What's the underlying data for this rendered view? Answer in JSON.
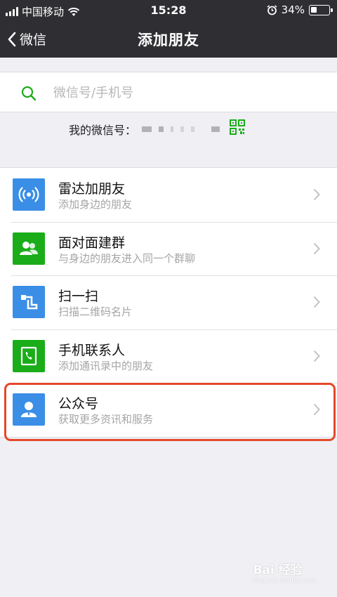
{
  "status_bar": {
    "carrier": "中国移动",
    "time": "15:28",
    "battery": "34%",
    "battery_level": 0.34
  },
  "nav": {
    "back_label": "微信",
    "title": "添加朋友"
  },
  "search": {
    "placeholder": "微信号/手机号"
  },
  "my_id": {
    "label": "我的微信号："
  },
  "menu": {
    "items": [
      {
        "title": "雷达加朋友",
        "subtitle": "添加身边的朋友",
        "icon": "radar-icon",
        "color": "#3a8ee6"
      },
      {
        "title": "面对面建群",
        "subtitle": "与身边的朋友进入同一个群聊",
        "icon": "group-icon",
        "color": "#1aad19"
      },
      {
        "title": "扫一扫",
        "subtitle": "扫描二维码名片",
        "icon": "scan-icon",
        "color": "#3a8ee6"
      },
      {
        "title": "手机联系人",
        "subtitle": "添加通讯录中的朋友",
        "icon": "phone-contact-icon",
        "color": "#1aad19"
      },
      {
        "title": "公众号",
        "subtitle": "获取更多资讯和服务",
        "icon": "official-account-icon",
        "color": "#3a8ee6"
      }
    ]
  },
  "watermark": {
    "text": "Bai 经验",
    "url": "jingyan.baidu.com"
  }
}
